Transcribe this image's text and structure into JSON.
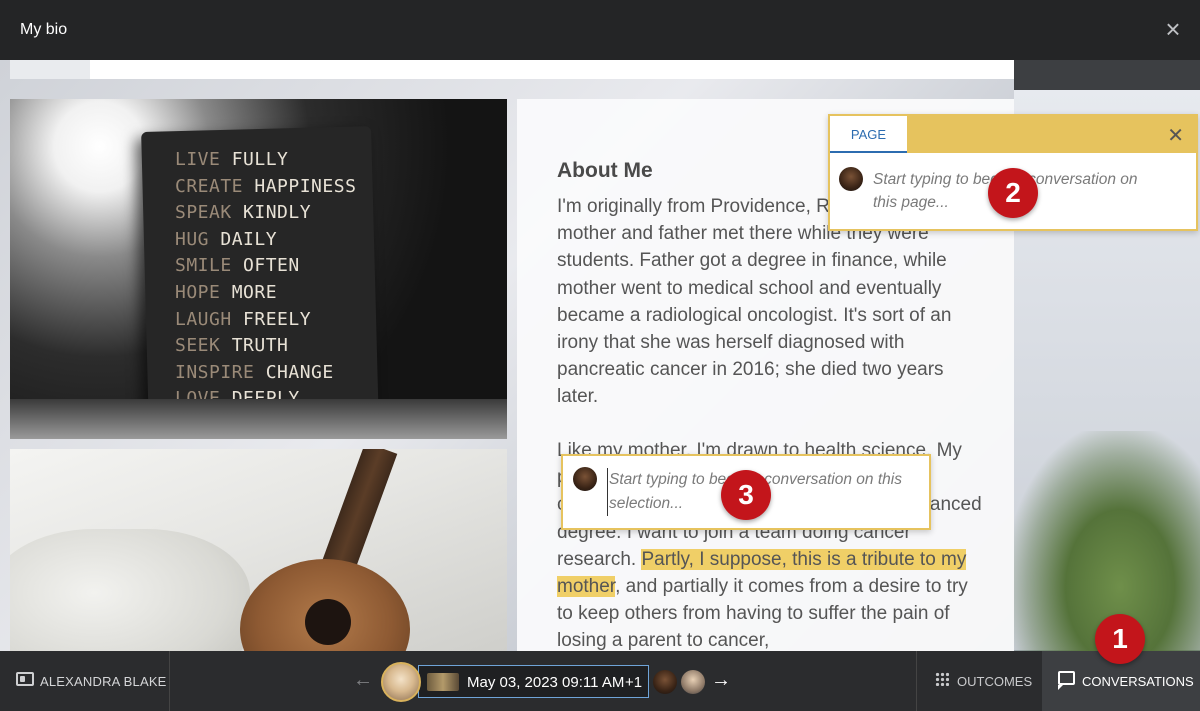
{
  "header": {
    "title": "My bio",
    "close_symbol": "×"
  },
  "photo_book": {
    "lines": [
      {
        "verb": "LIVE",
        "word": "FULLY"
      },
      {
        "verb": "CREATE",
        "word": "HAPPINESS"
      },
      {
        "verb": "SPEAK",
        "word": "KINDLY"
      },
      {
        "verb": "HUG",
        "word": "DAILY"
      },
      {
        "verb": "SMILE",
        "word": "OFTEN"
      },
      {
        "verb": "HOPE",
        "word": "MORE"
      },
      {
        "verb": "LAUGH",
        "word": "FREELY"
      },
      {
        "verb": "SEEK",
        "word": "TRUTH"
      },
      {
        "verb": "INSPIRE",
        "word": "CHANGE"
      },
      {
        "verb": "LOVE",
        "word": "DEEPLY"
      }
    ]
  },
  "document": {
    "heading": "About Me",
    "para1": "I'm originally from Providence, Rhode Island. My mother and father met there while they were students. Father got a degree in finance, while mother went to medical school and eventually became a radiological oncologist. It's sort of an irony that she was herself diagnosed with pancreatic cancer in 2016; she died two years later.",
    "para2_start": "Like my mother, I'm drawn to health science. My plan is to major in biology with an oncology concentration and then go on to earn an advanced degree. I want to join a team doing cancer research. ",
    "para2_highlight": "Partly, I suppose, this is a tribute to my mother",
    "para2_end": ", and partially it comes from a desire to try to keep others from having to suffer the pain of losing a parent to cancer,"
  },
  "page_popup": {
    "tab_label": "PAGE",
    "placeholder": "Start typing to begin a conversation on this page...",
    "close_symbol": "✕"
  },
  "selection_popup": {
    "placeholder": "Start typing to begin a conversation on this selection..."
  },
  "badges": {
    "one": "1",
    "two": "2",
    "three": "3"
  },
  "footer": {
    "user_name": "ALEXANDRA BLAKE",
    "back_arrow": "←",
    "forward_arrow": "→",
    "date": "May 03, 2023 09:11 AM",
    "extra_count": "+1",
    "outcomes_label": "OUTCOMES",
    "conversations_label": "CONVERSATIONS"
  },
  "colors": {
    "highlight": "#f0cf67",
    "badge": "#c3151b",
    "popup_border": "#e6c35e",
    "tab_accent": "#2c6cb0"
  }
}
